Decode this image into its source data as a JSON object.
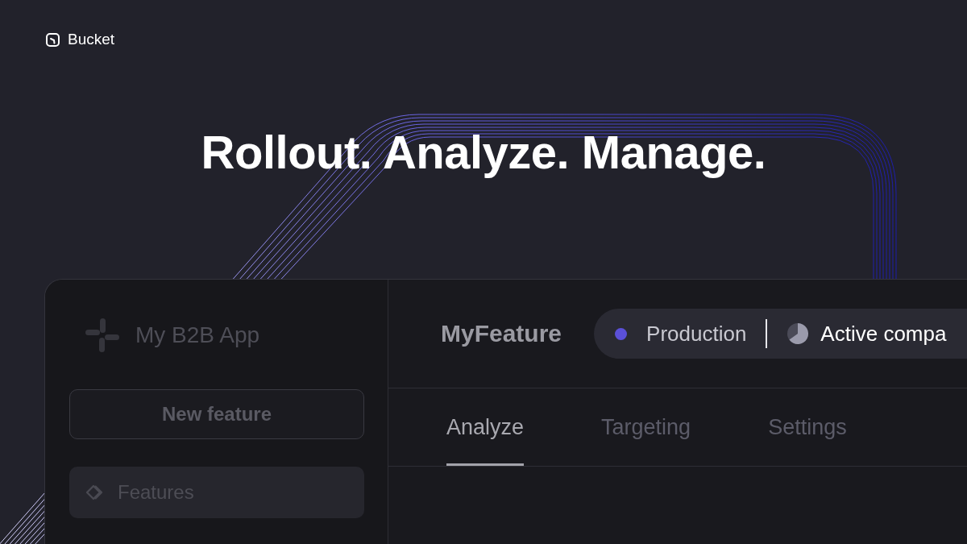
{
  "brand": {
    "name": "Bucket"
  },
  "headline": "Rollout. Analyze. Manage.",
  "app": {
    "sidebar": {
      "app_name": "My B2B App",
      "new_button": "New feature",
      "items": [
        {
          "label": "Features",
          "selected": true
        }
      ]
    },
    "header": {
      "feature_name": "MyFeature",
      "environment": "Production",
      "audience": "Active compa"
    },
    "tabs": [
      {
        "label": "Analyze",
        "selected": true
      },
      {
        "label": "Targeting",
        "selected": false
      },
      {
        "label": "Settings",
        "selected": false
      }
    ]
  }
}
